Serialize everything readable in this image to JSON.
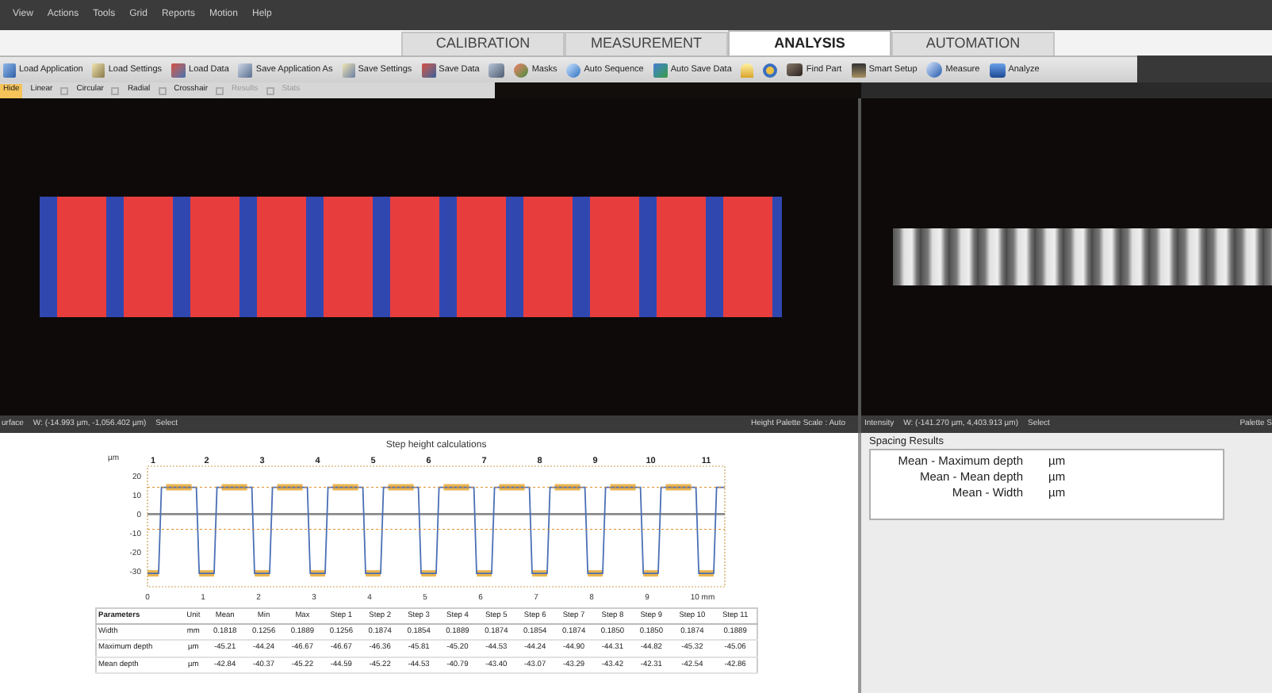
{
  "menu": [
    "View",
    "Actions",
    "Tools",
    "Grid",
    "Reports",
    "Motion",
    "Help"
  ],
  "tabs": [
    {
      "label": "CALIBRATION",
      "selected": false
    },
    {
      "label": "MEASUREMENT",
      "selected": false
    },
    {
      "label": "ANALYSIS",
      "selected": true
    },
    {
      "label": "AUTOMATION",
      "selected": false
    }
  ],
  "toolbar": [
    {
      "kind": "labeled",
      "label": "Load Application"
    },
    {
      "kind": "labeled",
      "label": "Load Settings"
    },
    {
      "kind": "labeled",
      "label": "Load Data"
    },
    {
      "kind": "labeled",
      "label": "Save Application As"
    },
    {
      "kind": "labeled",
      "label": "Save Settings"
    },
    {
      "kind": "labeled",
      "label": "Save Data"
    },
    {
      "kind": "icon"
    },
    {
      "kind": "labeled",
      "label": "Masks"
    },
    {
      "kind": "labeled",
      "label": "Auto Sequence"
    },
    {
      "kind": "labeled",
      "label": "Auto Save Data"
    },
    {
      "kind": "icon"
    },
    {
      "kind": "icon"
    },
    {
      "kind": "labeled",
      "label": "Find Part"
    },
    {
      "kind": "labeled",
      "label": "Smart Setup"
    },
    {
      "kind": "labeled",
      "label": "Measure"
    },
    {
      "kind": "labeled",
      "label": "Analyze"
    }
  ],
  "tools": [
    {
      "label": "Hide",
      "selected": true,
      "disabled": false
    },
    {
      "label": "Linear",
      "selected": false,
      "disabled": false
    },
    {
      "label": "Circular",
      "selected": false,
      "disabled": false
    },
    {
      "label": "Radial",
      "selected": false,
      "disabled": false
    },
    {
      "label": "Crosshair",
      "selected": false,
      "disabled": false
    },
    {
      "label": "Results",
      "selected": false,
      "disabled": true
    },
    {
      "label": "Stats",
      "selected": false,
      "disabled": true
    }
  ],
  "left_status": {
    "mode": "urface",
    "coords": "W: (-14.993 µm, -1,056.402 µm)",
    "action": "Select",
    "palette": "Height Palette Scale : Auto"
  },
  "right_status": {
    "mode": "Intensity",
    "coords": "W: (-141.270 µm, 4,403.913 µm)",
    "action": "Select",
    "palette": "Palette S"
  },
  "profile": {
    "chart_data": {
      "type": "line",
      "title": "Step height calculations",
      "ylabel": "µm",
      "xlim": [
        0,
        10.4
      ],
      "ylim": [
        -38,
        25
      ],
      "xticks": [
        0,
        1,
        2,
        3,
        4,
        5,
        6,
        7,
        8,
        9,
        {
          "value": 10,
          "label": "10 mm"
        }
      ],
      "yticks": [
        20,
        10,
        0,
        -10,
        -20,
        -30
      ],
      "x": [
        0,
        0.2,
        0.25,
        0.88,
        0.93,
        1.2,
        1.25,
        1.88,
        1.93,
        2.2,
        2.25,
        2.88,
        2.93,
        3.2,
        3.25,
        3.88,
        3.93,
        4.2,
        4.25,
        4.88,
        4.93,
        5.2,
        5.25,
        5.88,
        5.93,
        6.2,
        6.25,
        6.88,
        6.93,
        7.2,
        7.25,
        7.88,
        7.93,
        8.2,
        8.25,
        8.88,
        8.93,
        9.2,
        9.25,
        9.88,
        9.93,
        10.2,
        10.25,
        10.4
      ],
      "series": [
        {
          "color": "#4a6fb5",
          "values": [
            -31,
            -31,
            14,
            14,
            -31,
            -31,
            14,
            14,
            -31,
            -31,
            14,
            14,
            -31,
            -31,
            14,
            14,
            -31,
            -31,
            14,
            14,
            -31,
            -31,
            14,
            14,
            -31,
            -31,
            14,
            14,
            -31,
            -31,
            14,
            14,
            -31,
            -31,
            14,
            14,
            -31,
            -31,
            14,
            14,
            -31,
            -31,
            14,
            14
          ]
        },
        {
          "color": "#e08a20",
          "line_style": "dashed",
          "values": [
            14,
            14,
            14,
            14,
            14,
            14,
            14,
            14,
            14,
            14,
            14,
            14,
            14,
            14,
            14,
            14,
            14,
            14,
            14,
            14,
            14,
            14,
            14,
            14,
            14,
            14,
            14,
            14,
            14,
            14,
            14,
            14,
            14,
            14,
            14,
            14,
            14,
            14,
            14,
            14,
            14,
            14,
            14,
            14
          ]
        },
        {
          "color": "#e08a20",
          "line_style": "dashed",
          "values": [
            -8,
            -8,
            -8,
            -8,
            -8,
            -8,
            -8,
            -8,
            -8,
            -8,
            -8,
            -8,
            -8,
            -8,
            -8,
            -8,
            -8,
            -8,
            -8,
            -8,
            -8,
            -8,
            -8,
            -8,
            -8,
            -8,
            -8,
            -8,
            -8,
            -8,
            -8,
            -8,
            -8,
            -8,
            -8,
            -8,
            -8,
            -8,
            -8,
            -8,
            -8,
            -8,
            -8,
            -8
          ]
        }
      ],
      "annotations": [
        "1",
        "2",
        "3",
        "4",
        "5",
        "6",
        "7",
        "8",
        "9",
        "10",
        "11"
      ]
    },
    "table": {
      "columns": [
        "Parameters",
        "Unit",
        "Mean",
        "Min",
        "Max",
        "Step 1",
        "Step 2",
        "Step 3",
        "Step 4",
        "Step 5",
        "Step 6",
        "Step 7",
        "Step 8",
        "Step 9",
        "Step 10",
        "Step 11"
      ],
      "rows": [
        [
          "Width",
          "mm",
          "0.1818",
          "0.1256",
          "0.1889",
          "0.1256",
          "0.1874",
          "0.1854",
          "0.1889",
          "0.1874",
          "0.1854",
          "0.1874",
          "0.1850",
          "0.1850",
          "0.1874",
          "0.1889"
        ],
        [
          "Maximum depth",
          "µm",
          "-45.21",
          "-44.24",
          "-46.67",
          "-46.67",
          "-46.36",
          "-45.81",
          "-45.20",
          "-44.53",
          "-44.24",
          "-44.90",
          "-44.31",
          "-44.82",
          "-45.32",
          "-45.06"
        ],
        [
          "Mean depth",
          "µm",
          "-42.84",
          "-40.37",
          "-45.22",
          "-44.59",
          "-45.22",
          "-44.53",
          "-40.79",
          "-43.40",
          "-43.07",
          "-43.29",
          "-43.42",
          "-42.31",
          "-42.54",
          "-42.86"
        ]
      ]
    }
  },
  "spacing": {
    "title": "Spacing Results",
    "rows": [
      {
        "label": "Mean - Maximum depth",
        "unit": "µm"
      },
      {
        "label": "Mean - Mean depth",
        "unit": "µm"
      },
      {
        "label": "Mean - Width",
        "unit": "µm"
      }
    ]
  }
}
